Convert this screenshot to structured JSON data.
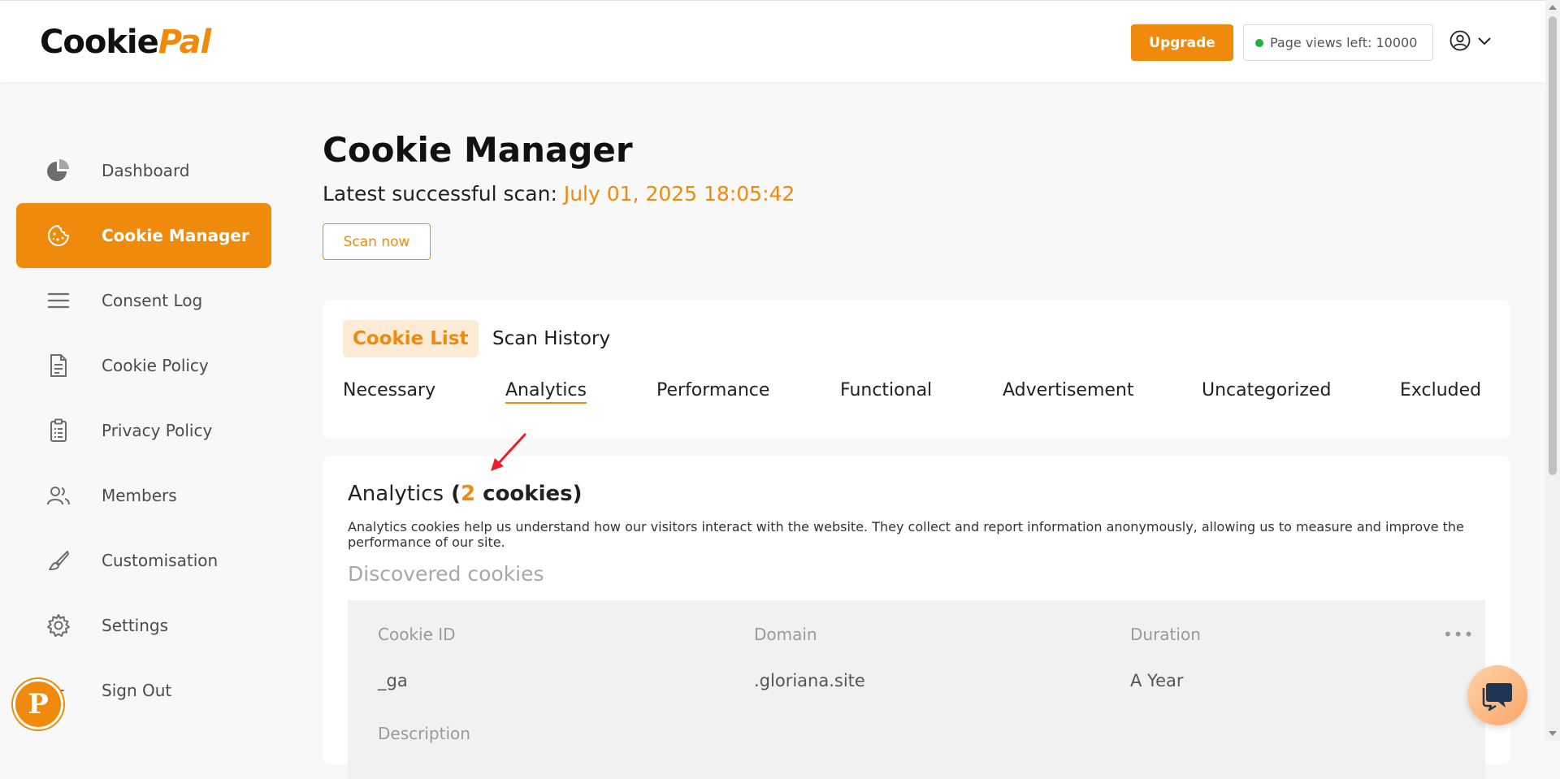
{
  "header": {
    "logo_cookie": "Cookie",
    "logo_pal": "Pal",
    "upgrade_label": "Upgrade",
    "pageviews_label": "Page views left: 10000"
  },
  "sidebar": {
    "items": [
      {
        "label": "Dashboard",
        "icon": "pie-chart-icon"
      },
      {
        "label": "Cookie Manager",
        "icon": "cookie-icon",
        "active": true
      },
      {
        "label": "Consent Log",
        "icon": "menu-lines-icon"
      },
      {
        "label": "Cookie Policy",
        "icon": "document-icon"
      },
      {
        "label": "Privacy Policy",
        "icon": "clipboard-icon"
      },
      {
        "label": "Members",
        "icon": "users-icon"
      },
      {
        "label": "Customisation",
        "icon": "brush-icon"
      },
      {
        "label": "Settings",
        "icon": "gear-icon"
      },
      {
        "label": "Sign Out",
        "icon": "sign-out-icon"
      }
    ]
  },
  "main": {
    "title": "Cookie Manager",
    "scan_prefix": "Latest successful scan: ",
    "scan_date": "July 01, 2025 18:05:42",
    "scan_button": "Scan now",
    "tabs": [
      {
        "label": "Cookie List",
        "active": true
      },
      {
        "label": "Scan History",
        "active": false
      }
    ],
    "categories": [
      {
        "label": "Necessary"
      },
      {
        "label": "Analytics",
        "active": true
      },
      {
        "label": "Performance"
      },
      {
        "label": "Functional"
      },
      {
        "label": "Advertisement"
      },
      {
        "label": "Uncategorized"
      },
      {
        "label": "Excluded"
      }
    ],
    "section": {
      "name": "Analytics",
      "open_paren": " (",
      "count": "2",
      "count_word": " cookies",
      "close_paren": ")",
      "description": "Analytics cookies help us understand how our visitors interact with the website. They collect and report information anonymously, allowing us to measure and improve the performance of our site.",
      "discovered_label": "Discovered cookies"
    },
    "table": {
      "headers": [
        "Cookie ID",
        "Domain",
        "Duration"
      ],
      "rows": [
        {
          "cookie_id": "_ga",
          "domain": ".gloriana.site",
          "duration": "A Year"
        }
      ],
      "description_label": "Description",
      "more_label": "•••"
    }
  },
  "colors": {
    "accent": "#ef8a0c",
    "accent_soft": "#fdebd6",
    "status_green": "#1fb141",
    "annotation_red": "#e8202a"
  },
  "floating": {
    "promo_letter": "P"
  }
}
